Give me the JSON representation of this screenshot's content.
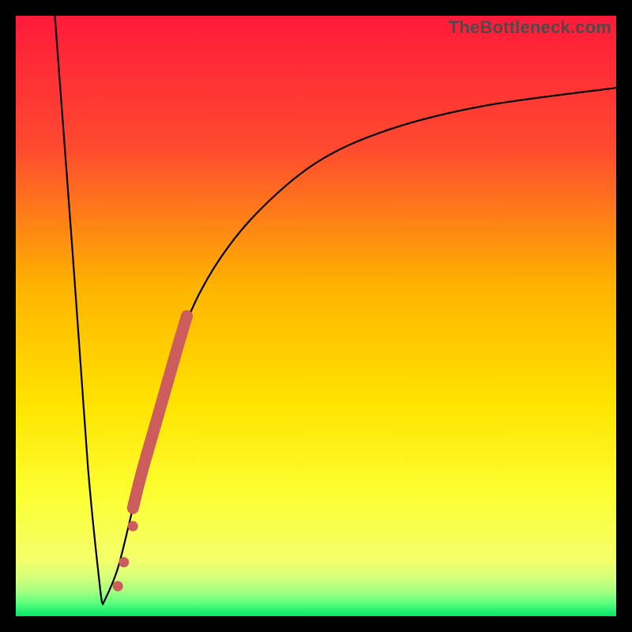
{
  "watermark": "TheBottleneck.com",
  "colors": {
    "frame": "#000000",
    "curve_stroke": "#000000",
    "blob_fill": "#cd5c5c",
    "gradient_stops": [
      {
        "offset": 0.0,
        "color": "#ff1a3a"
      },
      {
        "offset": 0.22,
        "color": "#ff4a2f"
      },
      {
        "offset": 0.45,
        "color": "#ffb300"
      },
      {
        "offset": 0.65,
        "color": "#ffe400"
      },
      {
        "offset": 0.8,
        "color": "#fcff33"
      },
      {
        "offset": 0.905,
        "color": "#f4ff6a"
      },
      {
        "offset": 0.935,
        "color": "#d6ff7a"
      },
      {
        "offset": 0.958,
        "color": "#a6ff82"
      },
      {
        "offset": 0.978,
        "color": "#5cff7e"
      },
      {
        "offset": 1.0,
        "color": "#00e865"
      }
    ]
  },
  "chart_data": {
    "type": "line",
    "title": "",
    "xlabel": "",
    "ylabel": "",
    "xlim": [
      0,
      100
    ],
    "ylim": [
      0,
      100
    ],
    "left_branch": {
      "name": "descending-left",
      "x": [
        6.5,
        9.5,
        12.0,
        14.0,
        14.5
      ],
      "y": [
        100,
        60,
        25,
        5,
        2
      ]
    },
    "right_branch": {
      "name": "ascending-saturating-right",
      "x": [
        14.5,
        17,
        20,
        24,
        28,
        33,
        40,
        50,
        62,
        78,
        100
      ],
      "y": [
        2,
        8,
        20,
        35,
        48,
        58,
        67,
        75.5,
        81,
        85,
        88
      ]
    },
    "highlight_segment": {
      "name": "thick-red-overlay",
      "x": [
        19.5,
        21.0,
        23.0,
        25.0,
        27.0,
        28.5
      ],
      "y": [
        18,
        24,
        31,
        38,
        45,
        50
      ]
    },
    "highlight_dots": {
      "name": "dots-near-minimum",
      "points": [
        {
          "x": 18.0,
          "y": 9.0
        },
        {
          "x": 17.0,
          "y": 5.0
        },
        {
          "x": 19.5,
          "y": 15.0
        }
      ]
    }
  }
}
